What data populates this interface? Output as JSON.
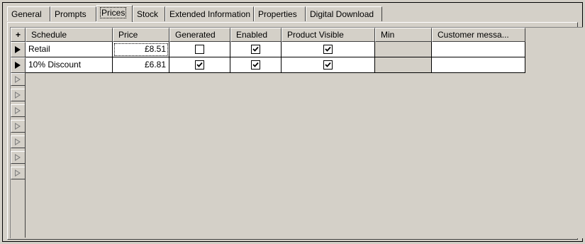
{
  "tabs": [
    {
      "label": "General",
      "active": false
    },
    {
      "label": "Prompts",
      "active": false
    },
    {
      "label": "Prices",
      "active": true
    },
    {
      "label": "Stock",
      "active": false
    },
    {
      "label": "Extended Information",
      "active": false
    },
    {
      "label": "Properties",
      "active": false
    },
    {
      "label": "Digital Download",
      "active": false
    }
  ],
  "grid": {
    "add_label": "+",
    "columns": [
      "Schedule",
      "Price",
      "Generated",
      "Enabled",
      "Product Visible",
      "Min",
      "Customer messa..."
    ],
    "rows": [
      {
        "schedule": "Retail",
        "price": "£8.51",
        "generated": false,
        "enabled": true,
        "product_visible": true,
        "min": "",
        "customer_message": ""
      },
      {
        "schedule": "10% Discount",
        "price": "£6.81",
        "generated": true,
        "enabled": true,
        "product_visible": true,
        "min": "",
        "customer_message": ""
      }
    ],
    "empty_row_indicators": 7
  },
  "colors": {
    "face": "#d4d0c8",
    "cell": "#ffffff",
    "shadow": "#404040"
  }
}
